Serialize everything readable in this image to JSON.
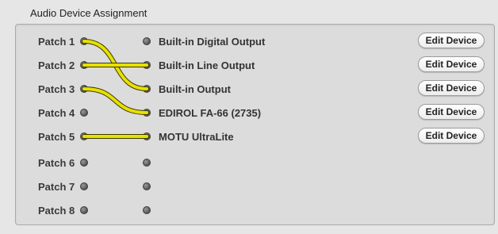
{
  "group": {
    "title": "Audio Device Assignment"
  },
  "rows": [
    {
      "patch": "Patch 1",
      "device": "Built-in Digital Output",
      "button": "Edit Device"
    },
    {
      "patch": "Patch 2",
      "device": "Built-in Line Output",
      "button": "Edit Device"
    },
    {
      "patch": "Patch 3",
      "device": "Built-in Output",
      "button": "Edit Device"
    },
    {
      "patch": "Patch 4",
      "device": "EDIROL FA-66 (2735)",
      "button": "Edit Device"
    },
    {
      "patch": "Patch 5",
      "device": "MOTU UltraLite",
      "button": "Edit Device"
    },
    {
      "patch": "Patch 6",
      "device": "",
      "button": ""
    },
    {
      "patch": "Patch 7",
      "device": "",
      "button": ""
    },
    {
      "patch": "Patch 8",
      "device": "",
      "button": ""
    }
  ],
  "connections": [
    {
      "from": 1,
      "to": 3
    },
    {
      "from": 2,
      "to": 2
    },
    {
      "from": 3,
      "to": 4
    },
    {
      "from": 5,
      "to": 5
    }
  ],
  "colors": {
    "cable": "#e8e000",
    "cable_outline": "#3a3a00"
  }
}
